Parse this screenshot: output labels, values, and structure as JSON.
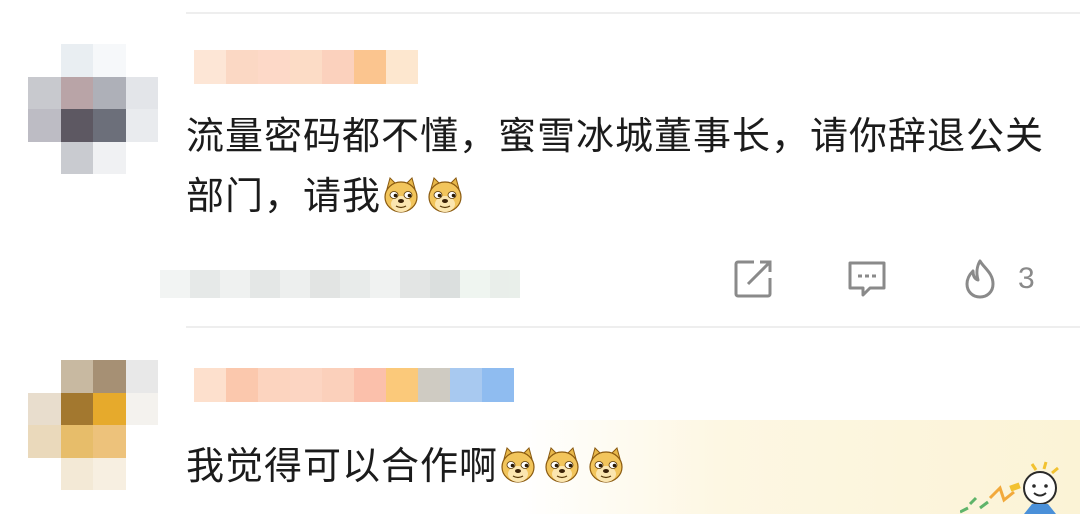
{
  "comments": [
    {
      "text": "流量密码都不懂，蜜雪冰城董事长，请你辞退公关部门，请我",
      "emoji": [
        "doge-icon",
        "doge-icon"
      ],
      "likes": "3"
    },
    {
      "text": "我觉得可以合作啊",
      "emoji": [
        "doge-icon",
        "doge-icon",
        "doge-icon"
      ]
    }
  ],
  "colors": {
    "text": "#1b1b1b",
    "action_icon": "#8a8a8a",
    "divider": "#eeeeee",
    "highlight": "#fbf3d6"
  },
  "icons": {
    "share": "share-icon",
    "reply": "comment-icon",
    "like": "fire-like-icon"
  }
}
